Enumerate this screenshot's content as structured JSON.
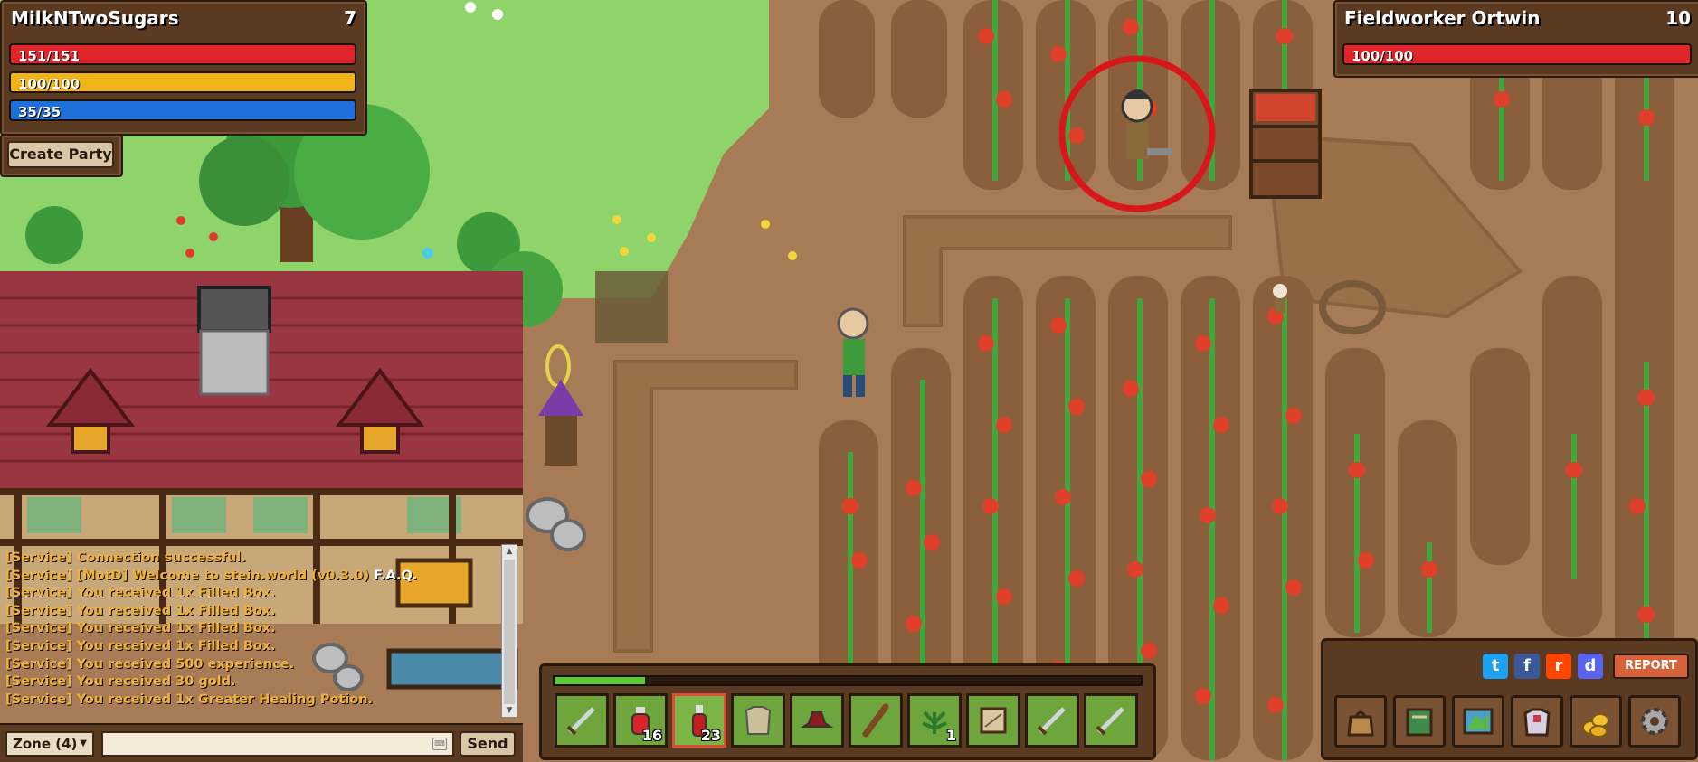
{
  "player": {
    "name": "MilkNTwoSugars",
    "level": "7",
    "health": {
      "label": "151/151",
      "fraction": 1.0,
      "color": "#e0242a"
    },
    "energy": {
      "label": "100/100",
      "fraction": 1.0,
      "color": "#f0b418"
    },
    "mana": {
      "label": "35/35",
      "fraction": 1.0,
      "color": "#1f6fd8"
    }
  },
  "party": {
    "create_label": "Create Party"
  },
  "target": {
    "name": "Fieldworker Ortwin",
    "level": "10",
    "health": {
      "label": "100/100",
      "fraction": 1.0,
      "color": "#e0242a"
    }
  },
  "chat": {
    "lines": [
      "[Service] Connection successful.",
      "[Service] [MotD] Welcome to stein.world (v0.3.0)",
      "[Service] You received 1x Filled Box.",
      "[Service] You received 1x Filled Box.",
      "[Service] You received 1x Filled Box.",
      "[Service] You received 1x Filled Box.",
      "[Service] You received 500 experience.",
      "[Service] You received 30 gold.",
      "[Service] You received 1x Greater Healing Potion."
    ],
    "faq_link": "F.A.Q.",
    "channel": "Zone (4)",
    "input_value": "",
    "send_label": "Send"
  },
  "hotbar": {
    "xp_fraction": 0.155,
    "slots": [
      {
        "icon": "sword-icon",
        "count": ""
      },
      {
        "icon": "health-potion-icon",
        "count": "16"
      },
      {
        "icon": "greater-health-potion-icon",
        "count": "23",
        "selected": true
      },
      {
        "icon": "armor-shirt-icon",
        "count": ""
      },
      {
        "icon": "hat-icon",
        "count": ""
      },
      {
        "icon": "club-icon",
        "count": ""
      },
      {
        "icon": "herb-icon",
        "count": "1"
      },
      {
        "icon": "map-scroll-icon",
        "count": ""
      },
      {
        "icon": "sword-icon",
        "count": ""
      },
      {
        "icon": "sword-icon",
        "count": ""
      }
    ]
  },
  "menu": {
    "social": [
      "twitter-icon",
      "facebook-icon",
      "reddit-icon",
      "discord-icon"
    ],
    "report_label": "REPORT",
    "buttons": [
      "inventory-bag-icon",
      "quest-book-icon",
      "world-map-icon",
      "character-armor-icon",
      "gold-coins-icon",
      "settings-gear-icon"
    ]
  },
  "colors": {
    "panel": "#5b3a22",
    "panel_border": "#2a1a0e",
    "chat_text": "#f0b23a",
    "grass": "#8fd46a",
    "dirt": "#a77b55"
  }
}
